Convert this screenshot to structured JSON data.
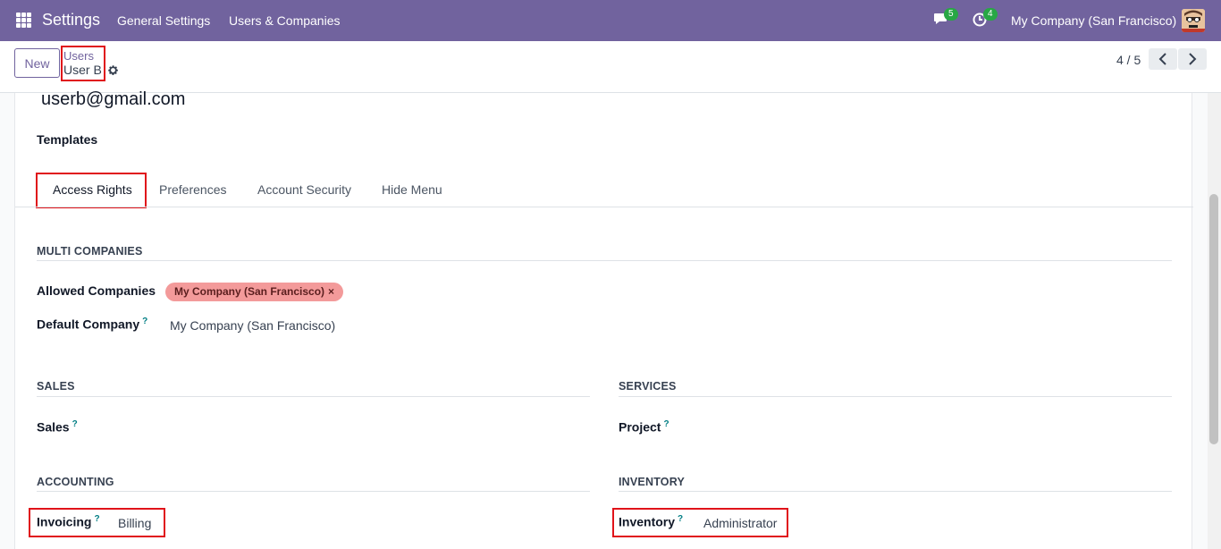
{
  "navbar": {
    "app_title": "Settings",
    "menu": [
      "General Settings",
      "Users & Companies"
    ],
    "messages_count": "5",
    "activities_count": "4",
    "company": "My Company (San Francisco)"
  },
  "control_panel": {
    "new_label": "New",
    "breadcrumb_parent": "Users",
    "breadcrumb_current": "User B",
    "pager": "4 / 5"
  },
  "form": {
    "email": "userb@gmail.com",
    "templates_label": "Templates",
    "tabs": [
      "Access Rights",
      "Preferences",
      "Account Security",
      "Hide Menu"
    ],
    "multi_companies": {
      "title": "MULTI COMPANIES",
      "allowed_label": "Allowed Companies",
      "allowed_tag": "My Company (San Francisco)",
      "default_label": "Default Company",
      "default_value": "My Company (San Francisco)"
    },
    "sales": {
      "title": "SALES",
      "sales_label": "Sales"
    },
    "services": {
      "title": "SERVICES",
      "project_label": "Project"
    },
    "accounting": {
      "title": "ACCOUNTING",
      "invoicing_label": "Invoicing",
      "invoicing_value": "Billing"
    },
    "inventory": {
      "title": "INVENTORY",
      "inventory_label": "Inventory",
      "inventory_value": "Administrator"
    }
  },
  "colors": {
    "navbar": "#71639e",
    "highlight": "#e0131a",
    "tag": "#f39a9a",
    "badge": "#28a745"
  }
}
